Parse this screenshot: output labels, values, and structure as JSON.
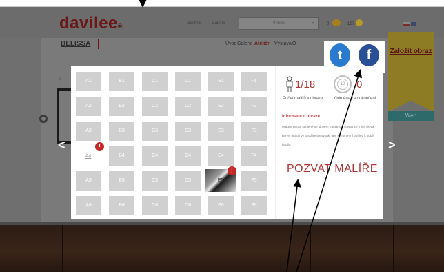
{
  "site": {
    "logo": "davilee",
    "logo_mark": "®",
    "header_links": [
      "Jak hrát",
      "Galerie",
      "Přihlásit"
    ],
    "search_placeholder": "Přehled",
    "search_button": "»",
    "stat_one": "0",
    "stat_two": "107",
    "artist_name": "BELISSA",
    "nav": [
      "Úvod",
      "Galerie",
      "Ateliér",
      "Výstava",
      "O"
    ],
    "nav_active": "Ateliér",
    "ribbon_text": "Založit obraz",
    "web_button": "Web",
    "prev_arrow": "<",
    "next_arrow": ">"
  },
  "grid": {
    "cells": [
      [
        "A1",
        "B1",
        "C1",
        "D1",
        "E1",
        "F1"
      ],
      [
        "A2",
        "B2",
        "C2",
        "D2",
        "E2",
        "F2"
      ],
      [
        "A3",
        "B3",
        "C3",
        "D3",
        "E3",
        "F3"
      ],
      [
        "A4",
        "B4",
        "C4",
        "D4",
        "E4",
        "F4"
      ],
      [
        "A5",
        "B5",
        "C5",
        "D5",
        "E5",
        "F5"
      ],
      [
        "A6",
        "B6",
        "C6",
        "D6",
        "E6",
        "F6"
      ]
    ],
    "warning_glyph": "!"
  },
  "sidebar": {
    "painters_count": "1/18",
    "reward_badge": "10",
    "reward_value": "0",
    "painters_caption": "Počet malířů v obraze",
    "reward_caption": "Odměna za dokončení",
    "info_title": "Informace o obraze",
    "info_text": "Malujte pocity spojené se slovem Elegance. Elegance mívá skrytě barvy, proto i vy použijte barvy tak, aby se na první pohled k sobě hodily.",
    "invite_label": "POZVAT MALÍŘE"
  },
  "social": {
    "twitter_glyph": "t",
    "facebook_glyph": "f"
  },
  "colors": {
    "accent": "#b03434",
    "brand": "#6b1717",
    "twitter": "#2a7bcf",
    "facebook": "#2b4f95"
  }
}
